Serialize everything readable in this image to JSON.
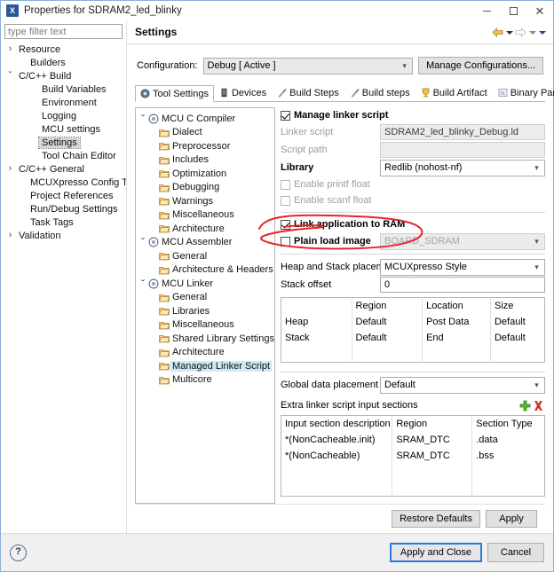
{
  "window": {
    "title": "Properties for SDRAM2_led_blinky",
    "app_icon": "X",
    "minimize": "minimize-icon",
    "maximize": "maximize-icon",
    "close": "close-icon"
  },
  "filter": {
    "placeholder": "type filter text",
    "value": "type filter text"
  },
  "nav_tree": [
    {
      "label": "Resource",
      "indent": 0,
      "arrow": "collapsed",
      "selected": false
    },
    {
      "label": "Builders",
      "indent": 1,
      "arrow": "none",
      "selected": false
    },
    {
      "label": "C/C++ Build",
      "indent": 0,
      "arrow": "expanded",
      "selected": false
    },
    {
      "label": "Build Variables",
      "indent": 2,
      "arrow": "none",
      "selected": false
    },
    {
      "label": "Environment",
      "indent": 2,
      "arrow": "none",
      "selected": false
    },
    {
      "label": "Logging",
      "indent": 2,
      "arrow": "none",
      "selected": false
    },
    {
      "label": "MCU settings",
      "indent": 2,
      "arrow": "none",
      "selected": false
    },
    {
      "label": "Settings",
      "indent": 2,
      "arrow": "none",
      "selected": true
    },
    {
      "label": "Tool Chain Editor",
      "indent": 2,
      "arrow": "none",
      "selected": false
    },
    {
      "label": "C/C++ General",
      "indent": 0,
      "arrow": "collapsed",
      "selected": false
    },
    {
      "label": "MCUXpresso Config Tools",
      "indent": 1,
      "arrow": "none",
      "selected": false
    },
    {
      "label": "Project References",
      "indent": 1,
      "arrow": "none",
      "selected": false
    },
    {
      "label": "Run/Debug Settings",
      "indent": 1,
      "arrow": "none",
      "selected": false
    },
    {
      "label": "Task Tags",
      "indent": 1,
      "arrow": "none",
      "selected": false
    },
    {
      "label": "Validation",
      "indent": 0,
      "arrow": "collapsed",
      "selected": false
    }
  ],
  "pane": {
    "title": "Settings",
    "nav_back": "back-arrow-icon",
    "nav_forward": "forward-arrow-icon",
    "menu": "view-menu-icon"
  },
  "configuration": {
    "label": "Configuration:",
    "value": "Debug  [ Active ]",
    "manage_button": "Manage Configurations..."
  },
  "tabs": [
    {
      "label": "Tool Settings",
      "icon": "tool-settings-icon",
      "active": true
    },
    {
      "label": "Devices",
      "icon": "devices-icon",
      "active": false
    },
    {
      "label": "Build Steps",
      "icon": "build-steps-icon",
      "active": false
    },
    {
      "label": "Build steps",
      "icon": "build-steps-icon",
      "active": false
    },
    {
      "label": "Build Artifact",
      "icon": "build-artifact-icon",
      "active": false
    },
    {
      "label": "Binary Parsers",
      "icon": "binary-parsers-icon",
      "active": false
    }
  ],
  "tab_scroll": {
    "prev": "◄",
    "next": "►"
  },
  "tool_tree": [
    {
      "label": "MCU C Compiler",
      "level": 0,
      "arrow": "expanded",
      "icon": "tool-icon",
      "selected": false
    },
    {
      "label": "Dialect",
      "level": 1,
      "arrow": "none",
      "icon": "folder-icon",
      "selected": false
    },
    {
      "label": "Preprocessor",
      "level": 1,
      "arrow": "none",
      "icon": "folder-icon",
      "selected": false
    },
    {
      "label": "Includes",
      "level": 1,
      "arrow": "none",
      "icon": "folder-icon",
      "selected": false
    },
    {
      "label": "Optimization",
      "level": 1,
      "arrow": "none",
      "icon": "folder-icon",
      "selected": false
    },
    {
      "label": "Debugging",
      "level": 1,
      "arrow": "none",
      "icon": "folder-icon",
      "selected": false
    },
    {
      "label": "Warnings",
      "level": 1,
      "arrow": "none",
      "icon": "folder-icon",
      "selected": false
    },
    {
      "label": "Miscellaneous",
      "level": 1,
      "arrow": "none",
      "icon": "folder-icon",
      "selected": false
    },
    {
      "label": "Architecture",
      "level": 1,
      "arrow": "none",
      "icon": "folder-icon",
      "selected": false
    },
    {
      "label": "MCU Assembler",
      "level": 0,
      "arrow": "expanded",
      "icon": "tool-icon",
      "selected": false
    },
    {
      "label": "General",
      "level": 1,
      "arrow": "none",
      "icon": "folder-icon",
      "selected": false
    },
    {
      "label": "Architecture & Headers",
      "level": 1,
      "arrow": "none",
      "icon": "folder-icon",
      "selected": false
    },
    {
      "label": "MCU Linker",
      "level": 0,
      "arrow": "expanded",
      "icon": "tool-icon",
      "selected": false
    },
    {
      "label": "General",
      "level": 1,
      "arrow": "none",
      "icon": "folder-icon",
      "selected": false
    },
    {
      "label": "Libraries",
      "level": 1,
      "arrow": "none",
      "icon": "folder-icon",
      "selected": false
    },
    {
      "label": "Miscellaneous",
      "level": 1,
      "arrow": "none",
      "icon": "folder-icon",
      "selected": false
    },
    {
      "label": "Shared Library Settings",
      "level": 1,
      "arrow": "none",
      "icon": "folder-icon",
      "selected": false
    },
    {
      "label": "Architecture",
      "level": 1,
      "arrow": "none",
      "icon": "folder-icon",
      "selected": false
    },
    {
      "label": "Managed Linker Script",
      "level": 1,
      "arrow": "none",
      "icon": "folder-icon",
      "selected": true
    },
    {
      "label": "Multicore",
      "level": 1,
      "arrow": "none",
      "icon": "folder-icon",
      "selected": false
    }
  ],
  "form": {
    "manage_linker_script": {
      "label": "Manage linker script",
      "checked": true,
      "bold": true
    },
    "linker_script": {
      "label": "Linker script",
      "value": "SDRAM2_led_blinky_Debug.ld",
      "disabled": true
    },
    "script_path": {
      "label": "Script path",
      "value": "",
      "disabled": true
    },
    "library": {
      "label": "Library",
      "value": "Redlib (nohost-nf)"
    },
    "enable_printf_float": {
      "label": "Enable printf float",
      "checked": false
    },
    "enable_scanf_float": {
      "label": "Enable scanf float",
      "checked": false
    },
    "link_application_to_ram": {
      "label": "Link application to RAM",
      "checked": true,
      "bold": true
    },
    "plain_load_image": {
      "label": "Plain load image",
      "checked": false,
      "value": "BOARD_SDRAM",
      "disabled": true
    },
    "heap_stack_placement": {
      "label": "Heap and Stack placement",
      "value": "MCUXpresso Style"
    },
    "stack_offset": {
      "label": "Stack offset",
      "value": "0"
    },
    "heap_stack_table": {
      "headers": [
        "",
        "Region",
        "Location",
        "Size"
      ],
      "rows": [
        [
          "Heap",
          "Default",
          "Post Data",
          "Default"
        ],
        [
          "Stack",
          "Default",
          "End",
          "Default"
        ],
        [
          "",
          "",
          "",
          ""
        ]
      ]
    },
    "global_data_placement": {
      "label": "Global data placement",
      "value": "Default"
    },
    "extra_sections": {
      "label": "Extra linker script input sections",
      "add_icon": "add-icon",
      "delete_icon": "delete-icon",
      "headers": [
        "Input section description",
        "Region",
        "Section Type"
      ],
      "rows": [
        [
          "*(NonCacheable.init)",
          "SRAM_DTC",
          ".data"
        ],
        [
          "*(NonCacheable)",
          "SRAM_DTC",
          ".bss"
        ],
        [
          "",
          "",
          ""
        ],
        [
          "",
          "",
          ""
        ]
      ]
    }
  },
  "pane_buttons": {
    "restore_defaults": "Restore Defaults",
    "apply": "Apply"
  },
  "dialog_buttons": {
    "help": "?",
    "apply_and_close": "Apply and Close",
    "cancel": "Cancel"
  },
  "annotation": {
    "type": "red-ellipse-highlight",
    "color": "#e8232a",
    "target": "Link application to RAM"
  },
  "colors": {
    "accent": "#2a7bd4",
    "selection": "#cde8f6",
    "annotation_red": "#e8232a",
    "add_green": "#4caf21",
    "delete_red": "#d3321e"
  }
}
